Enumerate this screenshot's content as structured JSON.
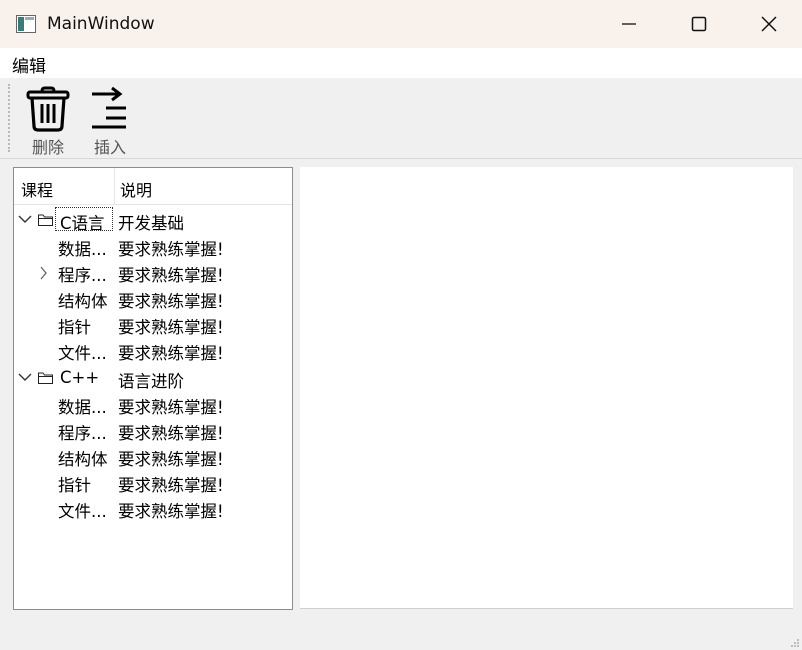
{
  "window": {
    "title": "MainWindow"
  },
  "menu": {
    "items": [
      {
        "label": "编辑"
      }
    ]
  },
  "toolbar": {
    "delete_label": "删除",
    "insert_label": "插入"
  },
  "tree": {
    "headers": {
      "col1": "课程",
      "col2": "说明"
    },
    "rows": [
      {
        "c1": "C语言",
        "c2": "开发基础"
      },
      {
        "c1": "数据...",
        "c2": "要求熟练掌握!"
      },
      {
        "c1": "程序...",
        "c2": "要求熟练掌握!"
      },
      {
        "c1": "结构体",
        "c2": "要求熟练掌握!"
      },
      {
        "c1": "指针",
        "c2": "要求熟练掌握!"
      },
      {
        "c1": "文件...",
        "c2": "要求熟练掌握!"
      },
      {
        "c1": "C++",
        "c2": "语言进阶"
      },
      {
        "c1": "数据...",
        "c2": "要求熟练掌握!"
      },
      {
        "c1": "程序...",
        "c2": "要求熟练掌握!"
      },
      {
        "c1": "结构体",
        "c2": "要求熟练掌握!"
      },
      {
        "c1": "指针",
        "c2": "要求熟练掌握!"
      },
      {
        "c1": "文件...",
        "c2": "要求熟练掌握!"
      }
    ]
  },
  "icons": {
    "app": "window-app-icon",
    "minimize": "minimize-icon",
    "maximize": "maximize-icon",
    "close": "close-icon",
    "delete": "trash-icon",
    "insert": "insert-arrow-icon",
    "folder": "folder-icon",
    "expanded": "chevron-down-icon",
    "collapsed": "chevron-right-icon"
  }
}
